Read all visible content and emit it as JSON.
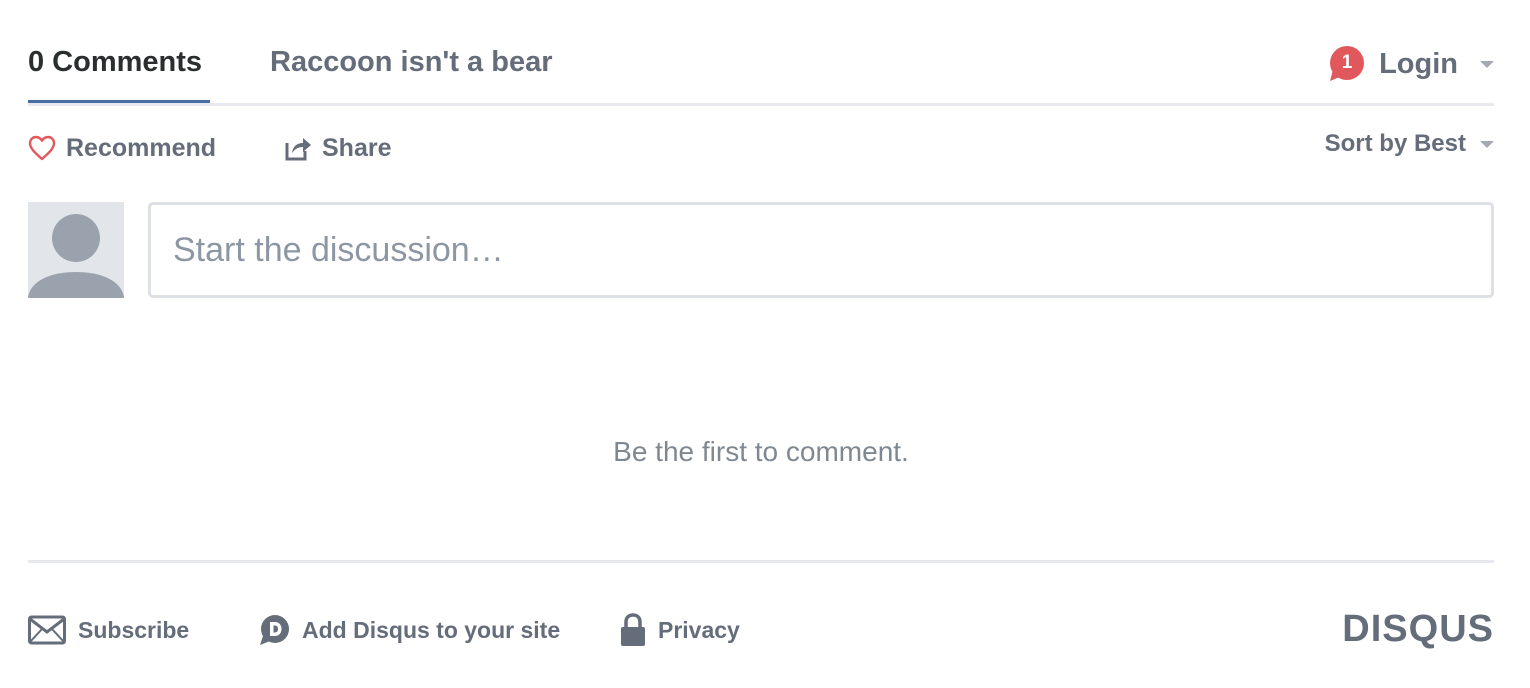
{
  "nav": {
    "comments_tab": "0 Comments",
    "community_tab": "Raccoon isn't a bear",
    "notification_count": "1",
    "login_label": "Login"
  },
  "actions": {
    "recommend_label": "Recommend",
    "share_label": "Share",
    "sort_label": "Sort by Best"
  },
  "composer": {
    "placeholder": "Start the discussion…"
  },
  "empty_state": "Be the first to comment.",
  "footer": {
    "subscribe_label": "Subscribe",
    "add_disqus_label": "Add Disqus to your site",
    "privacy_label": "Privacy",
    "brand": "DISQUS"
  },
  "colors": {
    "accent_underline": "#4a6fa5",
    "notification_badge": "#e0585b",
    "heart": "#e0585b",
    "text": "#656c7a"
  },
  "icons": [
    "comment-bubble-icon",
    "heart-icon",
    "share-icon",
    "avatar-icon",
    "envelope-icon",
    "disqus-logo-icon",
    "lock-icon"
  ]
}
